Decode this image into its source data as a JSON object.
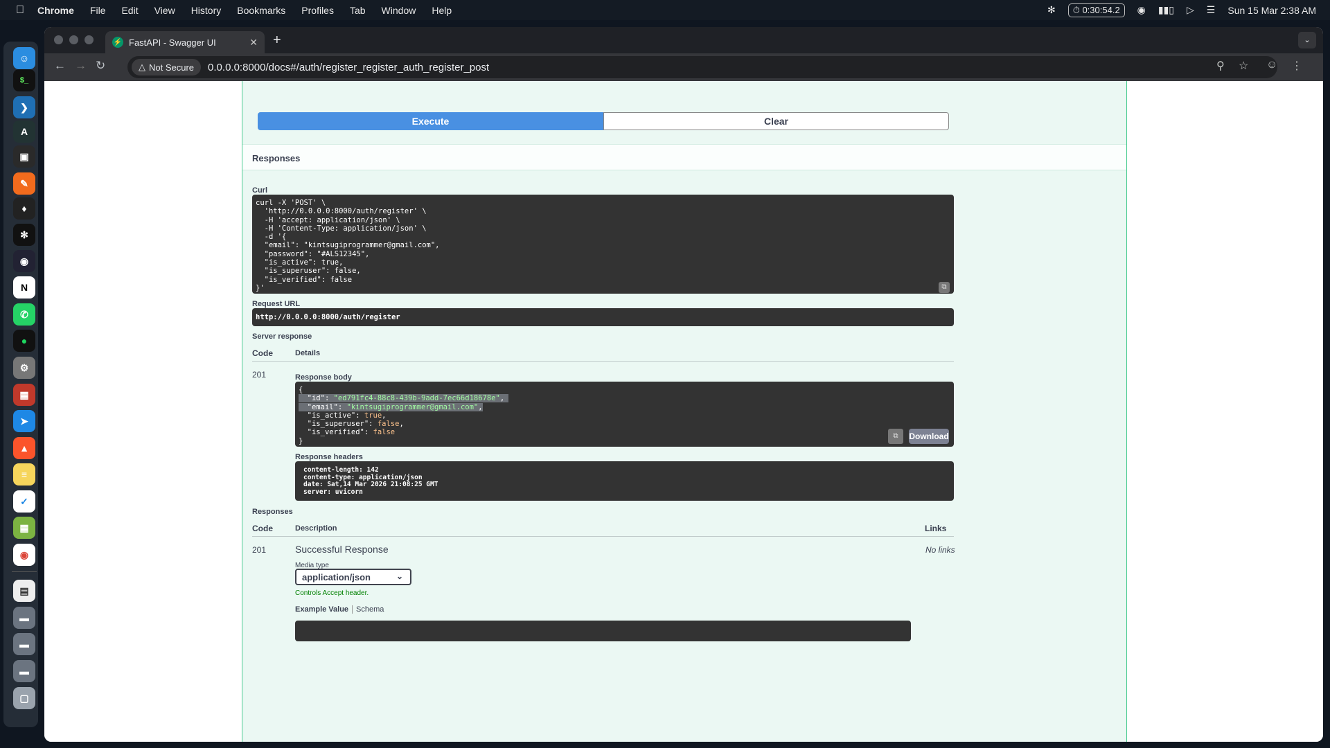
{
  "menubar": {
    "app": "Chrome",
    "items": [
      "File",
      "Edit",
      "View",
      "History",
      "Bookmarks",
      "Profiles",
      "Tab",
      "Window",
      "Help"
    ],
    "timer": "0:30:54.2",
    "datetime": "Sun 15 Mar  2:38 AM"
  },
  "browser": {
    "tab_title": "FastAPI - Swagger UI",
    "not_secure": "Not Secure",
    "url": "0.0.0.0:8000/docs#/auth/register_register_auth_register_post"
  },
  "swagger": {
    "execute_label": "Execute",
    "clear_label": "Clear",
    "responses_title": "Responses",
    "curl_label": "Curl",
    "curl_lines": [
      "curl -X 'POST' \\",
      "  'http://0.0.0.0:8000/auth/register' \\",
      "  -H 'accept: application/json' \\",
      "  -H 'Content-Type: application/json' \\",
      "  -d '{",
      "  \"email\": \"kintsugiprogrammer@gmail.com\",",
      "  \"password\": \"#ALS12345\",",
      "  \"is_active\": true,",
      "  \"is_superuser\": false,",
      "  \"is_verified\": false",
      "}'"
    ],
    "request_url_label": "Request URL",
    "request_url": "http://0.0.0.0:8000/auth/register",
    "server_response_label": "Server response",
    "col_code": "Code",
    "col_details": "Details",
    "response_code": "201",
    "response_body_label": "Response body",
    "response_body": {
      "open": "{",
      "id_key": "\"id\"",
      "id_val": "\"ed791fc4-88c8-439b-9add-7ec66d18678e\"",
      "email_key": "\"email\"",
      "email_val": "\"kintsugiprogrammer@gmail.com\"",
      "active_key": "\"is_active\"",
      "active_val": "true",
      "super_key": "\"is_superuser\"",
      "super_val": "false",
      "verified_key": "\"is_verified\"",
      "verified_val": "false",
      "close": "}"
    },
    "download_label": "Download",
    "response_headers_label": "Response headers",
    "response_headers": [
      "content-length: 142",
      "content-type: application/json",
      "date: Sat,14 Mar 2026 21:08:25 GMT",
      "server: uvicorn"
    ],
    "responses_label2": "Responses",
    "col_description": "Description",
    "col_links": "Links",
    "doc_code": "201",
    "doc_description": "Successful Response",
    "doc_links": "No links",
    "media_type_label": "Media type",
    "media_type_value": "application/json",
    "controls_note": "Controls Accept header.",
    "example_value_tab": "Example Value",
    "schema_tab": "Schema"
  }
}
